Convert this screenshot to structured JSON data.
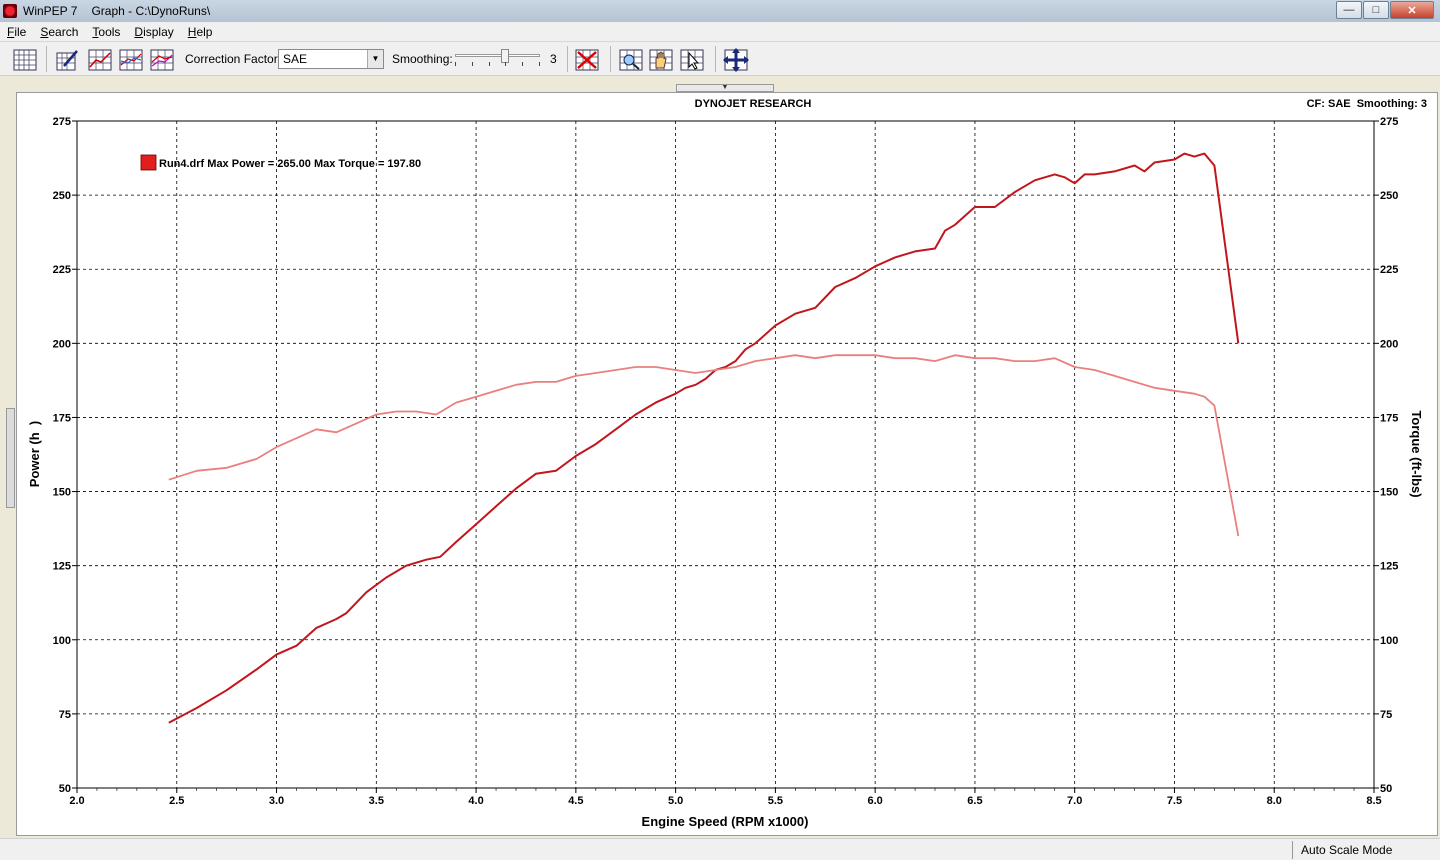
{
  "window": {
    "app_name": "WinPEP 7",
    "title": "Graph - C:\\DynoRuns\\"
  },
  "window_controls": {
    "minimize": "—",
    "maximize": "□",
    "close": "✕"
  },
  "menu": [
    {
      "label": "File",
      "key": "F",
      "rest": "ile"
    },
    {
      "label": "Search",
      "key": "S",
      "rest": "earch"
    },
    {
      "label": "Tools",
      "key": "T",
      "rest": "ools"
    },
    {
      "label": "Display",
      "key": "D",
      "rest": "isplay"
    },
    {
      "label": "Help",
      "key": "H",
      "rest": "elp"
    }
  ],
  "toolbar": {
    "correction_factor_label": "Correction Factor:",
    "correction_factor_value": "SAE",
    "smoothing_label": "Smoothing:",
    "smoothing_value": "3",
    "smoothing_level_fraction": 0.6,
    "icons": [
      "grid-icon",
      "graph-edit-icon",
      "graph-line-icon",
      "graph-multi-icon",
      "graph-overlay-icon",
      "clear-red-x-icon",
      "zoom-icon",
      "pan-hand-icon",
      "cursor-icon",
      "move-cross-icon"
    ]
  },
  "graph_header": {
    "company": "DYNOJET RESEARCH",
    "status_right": "CF: SAE  Smoothing: 3"
  },
  "legend": {
    "text": "Run4.drf Max Power = 265.00 Max Torque = 197.80",
    "swatch_color": "#e01e1e"
  },
  "status": {
    "mode": "Auto Scale Mode"
  },
  "colors": {
    "power": "#c0161c",
    "torque": "#e9807f"
  },
  "chart_data": {
    "type": "line",
    "xlabel": "Engine Speed (RPM x1000)",
    "ylabel": "Power (h  )",
    "y2label": "Torque (ft-lbs)",
    "xlim": [
      2.0,
      8.5
    ],
    "ylim": [
      50,
      275
    ],
    "y2lim": [
      50,
      275
    ],
    "xticks": [
      "2.0",
      "2.5",
      "3.0",
      "3.5",
      "4.0",
      "4.5",
      "5.0",
      "5.5",
      "6.0",
      "6.5",
      "7.0",
      "7.5",
      "8.0",
      "8.5"
    ],
    "yticks": [
      "50",
      "75",
      "100",
      "125",
      "150",
      "175",
      "200",
      "225",
      "250",
      "275"
    ],
    "grid": true,
    "series": [
      {
        "name": "Power",
        "axis": "left",
        "x": [
          2.46,
          2.6,
          2.75,
          2.9,
          3.0,
          3.1,
          3.2,
          3.3,
          3.35,
          3.45,
          3.55,
          3.65,
          3.75,
          3.82,
          3.9,
          4.0,
          4.1,
          4.2,
          4.3,
          4.4,
          4.5,
          4.6,
          4.7,
          4.8,
          4.9,
          5.0,
          5.05,
          5.1,
          5.15,
          5.2,
          5.25,
          5.3,
          5.35,
          5.4,
          5.5,
          5.6,
          5.7,
          5.8,
          5.9,
          6.0,
          6.1,
          6.2,
          6.3,
          6.35,
          6.4,
          6.5,
          6.6,
          6.7,
          6.8,
          6.9,
          6.95,
          7.0,
          7.05,
          7.1,
          7.2,
          7.3,
          7.35,
          7.4,
          7.5,
          7.55,
          7.6,
          7.65,
          7.7,
          7.82
        ],
        "values": [
          72,
          77,
          83,
          90,
          95,
          98,
          104,
          107,
          109,
          116,
          121,
          125,
          127,
          128,
          133,
          139,
          145,
          151,
          156,
          157,
          162,
          166,
          171,
          176,
          180,
          183,
          185,
          186,
          188,
          191,
          192,
          194,
          198,
          200,
          206,
          210,
          212,
          219,
          222,
          226,
          229,
          231,
          232,
          238,
          240,
          246,
          246,
          251,
          255,
          257,
          256,
          254,
          257,
          257,
          258,
          260,
          258,
          261,
          262,
          264,
          263,
          264,
          260,
          200
        ]
      },
      {
        "name": "Torque",
        "axis": "right",
        "x": [
          2.46,
          2.6,
          2.75,
          2.9,
          3.0,
          3.1,
          3.2,
          3.3,
          3.4,
          3.5,
          3.6,
          3.7,
          3.8,
          3.9,
          4.0,
          4.1,
          4.2,
          4.3,
          4.4,
          4.5,
          4.6,
          4.7,
          4.8,
          4.9,
          5.0,
          5.1,
          5.2,
          5.3,
          5.4,
          5.5,
          5.6,
          5.7,
          5.8,
          5.9,
          6.0,
          6.1,
          6.2,
          6.3,
          6.4,
          6.5,
          6.6,
          6.7,
          6.8,
          6.9,
          7.0,
          7.1,
          7.2,
          7.3,
          7.4,
          7.5,
          7.6,
          7.65,
          7.7,
          7.82
        ],
        "values": [
          154,
          157,
          158,
          161,
          165,
          168,
          171,
          170,
          173,
          176,
          177,
          177,
          176,
          180,
          182,
          184,
          186,
          187,
          187,
          189,
          190,
          191,
          192,
          192,
          191,
          190,
          191,
          192,
          194,
          195,
          196,
          195,
          196,
          196,
          196,
          195,
          195,
          194,
          196,
          195,
          195,
          194,
          194,
          195,
          192,
          191,
          189,
          187,
          185,
          184,
          183,
          182,
          179,
          135
        ]
      }
    ]
  }
}
